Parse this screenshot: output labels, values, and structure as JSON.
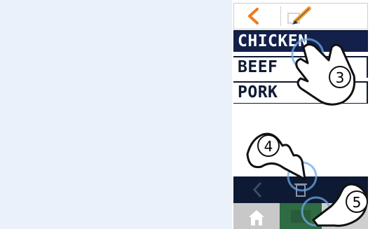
{
  "topbar": {
    "back_icon": "chevron-left-icon",
    "edit_icon": "pencil-icon"
  },
  "list": {
    "items": [
      "CHICKEN",
      "BEEF",
      "PORK"
    ],
    "selected_index": 0
  },
  "footer": {
    "back_icon": "chevron-left-icon",
    "delete_icon": "trash-icon"
  },
  "nav": {
    "home_icon": "home-icon",
    "confirm_icon": "check-icon"
  },
  "steps": {
    "tap_item": "3",
    "tap_delete": "4",
    "tap_confirm": "5"
  },
  "colors": {
    "accent": "#f07a1e",
    "dark": "#0e1a33",
    "selected": "#12204a",
    "confirm": "#2f6b43"
  }
}
